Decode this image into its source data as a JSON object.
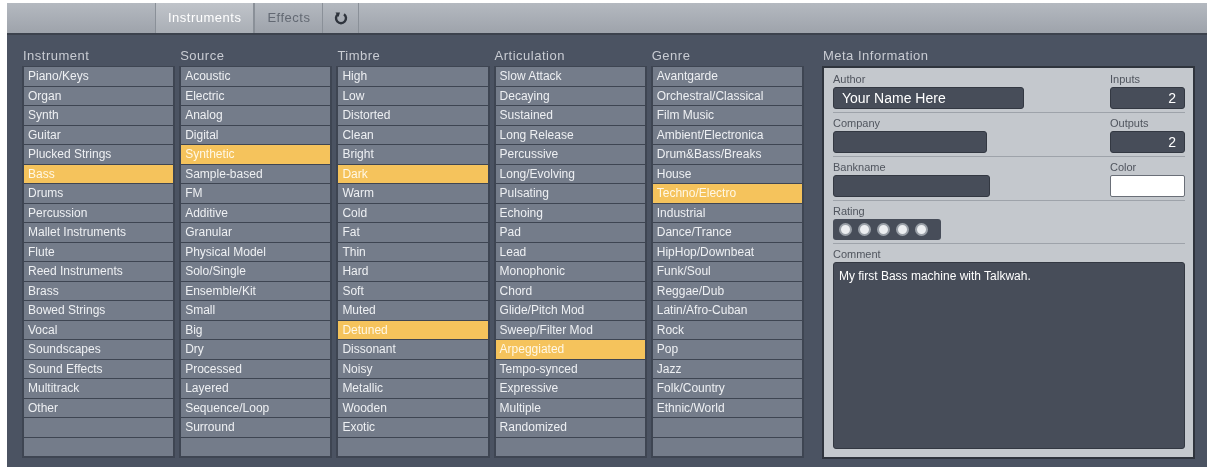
{
  "toolbar": {
    "tabs": [
      {
        "label": "Instruments",
        "selected": true,
        "disabled": false
      },
      {
        "label": "Effects",
        "selected": false,
        "disabled": true
      }
    ]
  },
  "columns": [
    {
      "title": "Instrument",
      "items": [
        {
          "label": "Piano/Keys",
          "selected": false
        },
        {
          "label": "Organ",
          "selected": false
        },
        {
          "label": "Synth",
          "selected": false
        },
        {
          "label": "Guitar",
          "selected": false
        },
        {
          "label": "Plucked Strings",
          "selected": false
        },
        {
          "label": "Bass",
          "selected": true
        },
        {
          "label": "Drums",
          "selected": false
        },
        {
          "label": "Percussion",
          "selected": false
        },
        {
          "label": "Mallet Instruments",
          "selected": false
        },
        {
          "label": "Flute",
          "selected": false
        },
        {
          "label": "Reed Instruments",
          "selected": false
        },
        {
          "label": "Brass",
          "selected": false
        },
        {
          "label": "Bowed Strings",
          "selected": false
        },
        {
          "label": "Vocal",
          "selected": false
        },
        {
          "label": "Soundscapes",
          "selected": false
        },
        {
          "label": "Sound Effects",
          "selected": false
        },
        {
          "label": "Multitrack",
          "selected": false
        },
        {
          "label": "Other",
          "selected": false
        }
      ]
    },
    {
      "title": "Source",
      "items": [
        {
          "label": "Acoustic",
          "selected": false
        },
        {
          "label": "Electric",
          "selected": false
        },
        {
          "label": "Analog",
          "selected": false
        },
        {
          "label": "Digital",
          "selected": false
        },
        {
          "label": "Synthetic",
          "selected": true
        },
        {
          "label": "Sample-based",
          "selected": false
        },
        {
          "label": "FM",
          "selected": false
        },
        {
          "label": "Additive",
          "selected": false
        },
        {
          "label": "Granular",
          "selected": false
        },
        {
          "label": "Physical Model",
          "selected": false
        },
        {
          "label": "Solo/Single",
          "selected": false
        },
        {
          "label": "Ensemble/Kit",
          "selected": false
        },
        {
          "label": "Small",
          "selected": false
        },
        {
          "label": "Big",
          "selected": false
        },
        {
          "label": "Dry",
          "selected": false
        },
        {
          "label": "Processed",
          "selected": false
        },
        {
          "label": "Layered",
          "selected": false
        },
        {
          "label": "Sequence/Loop",
          "selected": false
        },
        {
          "label": "Surround",
          "selected": false
        }
      ]
    },
    {
      "title": "Timbre",
      "items": [
        {
          "label": "High",
          "selected": false
        },
        {
          "label": "Low",
          "selected": false
        },
        {
          "label": "Distorted",
          "selected": false
        },
        {
          "label": "Clean",
          "selected": false
        },
        {
          "label": "Bright",
          "selected": false
        },
        {
          "label": "Dark",
          "selected": true
        },
        {
          "label": "Warm",
          "selected": false
        },
        {
          "label": "Cold",
          "selected": false
        },
        {
          "label": "Fat",
          "selected": false
        },
        {
          "label": "Thin",
          "selected": false
        },
        {
          "label": "Hard",
          "selected": false
        },
        {
          "label": "Soft",
          "selected": false
        },
        {
          "label": "Muted",
          "selected": false
        },
        {
          "label": "Detuned",
          "selected": true
        },
        {
          "label": "Dissonant",
          "selected": false
        },
        {
          "label": "Noisy",
          "selected": false
        },
        {
          "label": "Metallic",
          "selected": false
        },
        {
          "label": "Wooden",
          "selected": false
        },
        {
          "label": "Exotic",
          "selected": false
        }
      ]
    },
    {
      "title": "Articulation",
      "items": [
        {
          "label": "Slow Attack",
          "selected": false
        },
        {
          "label": "Decaying",
          "selected": false
        },
        {
          "label": "Sustained",
          "selected": false
        },
        {
          "label": "Long Release",
          "selected": false
        },
        {
          "label": "Percussive",
          "selected": false
        },
        {
          "label": "Long/Evolving",
          "selected": false
        },
        {
          "label": "Pulsating",
          "selected": false
        },
        {
          "label": "Echoing",
          "selected": false
        },
        {
          "label": "Pad",
          "selected": false
        },
        {
          "label": "Lead",
          "selected": false
        },
        {
          "label": "Monophonic",
          "selected": false
        },
        {
          "label": "Chord",
          "selected": false
        },
        {
          "label": "Glide/Pitch Mod",
          "selected": false
        },
        {
          "label": "Sweep/Filter Mod",
          "selected": false
        },
        {
          "label": "Arpeggiated",
          "selected": true
        },
        {
          "label": "Tempo-synced",
          "selected": false
        },
        {
          "label": "Expressive",
          "selected": false
        },
        {
          "label": "Multiple",
          "selected": false
        },
        {
          "label": "Randomized",
          "selected": false
        }
      ]
    },
    {
      "title": "Genre",
      "items": [
        {
          "label": "Avantgarde",
          "selected": false
        },
        {
          "label": "Orchestral/Classical",
          "selected": false
        },
        {
          "label": "Film Music",
          "selected": false
        },
        {
          "label": "Ambient/Electronica",
          "selected": false
        },
        {
          "label": "Drum&Bass/Breaks",
          "selected": false
        },
        {
          "label": "House",
          "selected": false
        },
        {
          "label": "Techno/Electro",
          "selected": true
        },
        {
          "label": "Industrial",
          "selected": false
        },
        {
          "label": "Dance/Trance",
          "selected": false
        },
        {
          "label": "HipHop/Downbeat",
          "selected": false
        },
        {
          "label": "Funk/Soul",
          "selected": false
        },
        {
          "label": "Reggae/Dub",
          "selected": false
        },
        {
          "label": "Latin/Afro-Cuban",
          "selected": false
        },
        {
          "label": "Rock",
          "selected": false
        },
        {
          "label": "Pop",
          "selected": false
        },
        {
          "label": "Jazz",
          "selected": false
        },
        {
          "label": "Folk/Country",
          "selected": false
        },
        {
          "label": "Ethnic/World",
          "selected": false
        }
      ]
    }
  ],
  "meta": {
    "title": "Meta Information",
    "author": {
      "label": "Author",
      "value": "Your Name Here"
    },
    "inputs": {
      "label": "Inputs",
      "value": "2"
    },
    "company": {
      "label": "Company"
    },
    "outputs": {
      "label": "Outputs",
      "value": "2"
    },
    "bankname": {
      "label": "Bankname"
    },
    "color": {
      "label": "Color",
      "color": "#ffffff"
    },
    "rating": {
      "label": "Rating"
    },
    "comment": {
      "label": "Comment",
      "value": "My first Bass machine with Talkwah."
    }
  }
}
